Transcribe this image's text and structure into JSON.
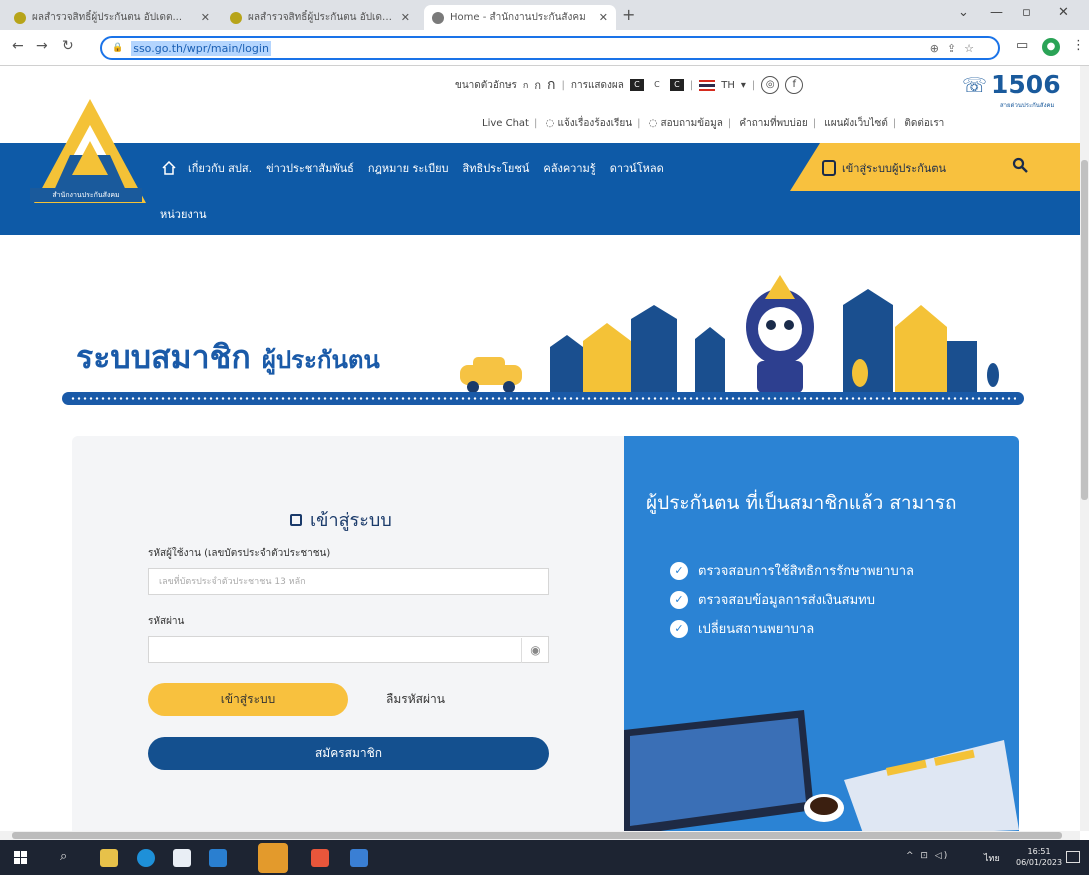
{
  "browser": {
    "tabs": [
      {
        "label": "ผลสำรวจสิทธิ์ผู้ประกันตน อัปเดต...",
        "favicon_color": "#b7a41a"
      },
      {
        "label": "ผลสำรวจสิทธิ์ผู้ประกันตน อัปเดต...",
        "favicon_color": "#b7a41a"
      },
      {
        "label": "Home - สำนักงานประกันสังคม",
        "favicon_color": "#7a7a7a"
      }
    ],
    "url": "sso.go.th/wpr/main/login"
  },
  "header": {
    "font_size_label": "ขนาดตัวอักษร",
    "font_sizes": [
      "ก",
      "ก",
      "ก"
    ],
    "contrast_label": "การแสดงผล",
    "contrast_options": [
      "C",
      "C",
      "C"
    ],
    "language": "TH",
    "hotline_number": "1506",
    "hotline_sub": "สายด่วนประกันสังคม",
    "links": [
      "Live Chat",
      "แจ้งเรื่องร้องเรียน",
      "สอบถามข้อมูล",
      "คำถามที่พบบ่อย",
      "แผนผังเว็บไซต์",
      "ติดต่อเรา"
    ],
    "logo_text": "สำนักงานประกันสังคม"
  },
  "nav": {
    "items": [
      "เกี่ยวกับ สปส.",
      "ข่าวประชาสัมพันธ์",
      "กฎหมาย ระเบียบ",
      "สิทธิประโยชน์",
      "คลังความรู้",
      "ดาวน์โหลด"
    ],
    "second_row": "หน่วยงาน",
    "login_link": "เข้าสู่ระบบผู้ประกันตน"
  },
  "banner": {
    "title_main": "ระบบสมาชิก",
    "title_sub": "ผู้ประกันตน"
  },
  "login": {
    "title": "เข้าสู่ระบบ",
    "username_label": "รหัสผู้ใช้งาน (เลขบัตรประจำตัวประชาชน)",
    "username_placeholder": "เลขที่บัตรประจำตัวประชาชน 13 หลัก",
    "password_label": "รหัสผ่าน",
    "password_placeholder": "",
    "login_button": "เข้าสู่ระบบ",
    "forgot_password": "ลืมรหัสผ่าน",
    "register_button": "สมัครสมาชิก"
  },
  "promo": {
    "title": "ผู้ประกันตน ที่เป็นสมาชิกแล้ว สามารถ",
    "items": [
      "ตรวจสอบการใช้สิทธิการรักษาพยาบาล",
      "ตรวจสอบข้อมูลการส่งเงินสมทบ",
      "เปลี่ยนสถานพยาบาล"
    ]
  },
  "taskbar": {
    "time": "16:51",
    "date": "06/01/2023",
    "lang": "ไทย"
  },
  "colors": {
    "nav_blue": "#0e5aa7",
    "accent_yellow": "#f8c13e",
    "promo_blue": "#2b83d4",
    "title_blue": "#1a5aa8",
    "register_blue": "#14508f"
  }
}
